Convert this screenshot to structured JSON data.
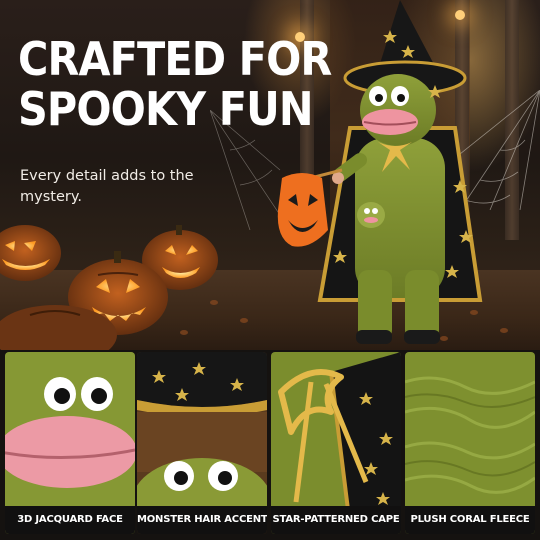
{
  "hero": {
    "title_line1": "CRAFTED FOR",
    "title_line2": "SPOOKY FUN",
    "subtitle": "Every detail adds to the mystery."
  },
  "features": [
    {
      "label": "3D JACQUARD FACE",
      "icon": "fuzzy-face-lips"
    },
    {
      "label": "MONSTER HAIR ACCENTS",
      "icon": "star-hat-hair"
    },
    {
      "label": "STAR-PATTERNED CAPE",
      "icon": "star-cape-ribbon"
    },
    {
      "label": "PLUSH CORAL FLEECE",
      "icon": "green-fleece"
    }
  ],
  "colors": {
    "fleece_green": "#7d8f2e",
    "lips_pink": "#e98f9b",
    "cape_black": "#141414",
    "star_gold": "#d7b44a",
    "pumpkin_orange": "#e8631a"
  }
}
